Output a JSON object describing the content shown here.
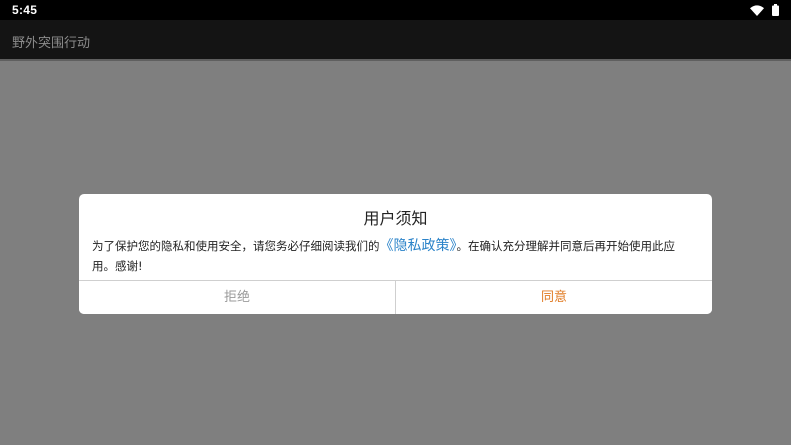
{
  "status_bar": {
    "time": "5:45",
    "icons": [
      "wifi-icon",
      "battery-icon"
    ]
  },
  "app_bar": {
    "title": "野外突围行动"
  },
  "dialog": {
    "title": "用户须知",
    "message_before": "为了保护您的隐私和使用安全，请您务必仔细阅读我们的",
    "policy_link": "《隐私政策》",
    "message_after": "。在确认充分理解并同意后再开始使用此应用。感谢!",
    "reject_label": "拒绝",
    "agree_label": "同意"
  },
  "colors": {
    "scrim": "#7f7f7f",
    "app_bar": "#141414",
    "link": "#2b83c9",
    "agree": "#e07a22",
    "reject": "#9a9a9a"
  }
}
